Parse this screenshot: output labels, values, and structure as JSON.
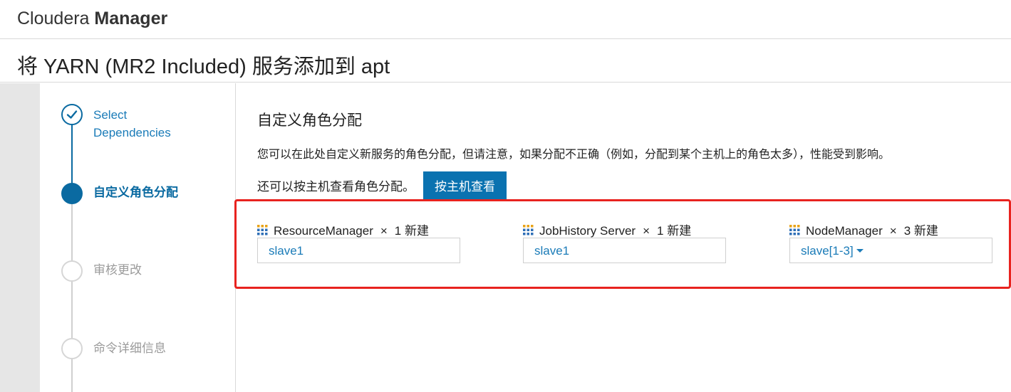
{
  "brand": {
    "light": "Cloudera",
    "bold": "Manager"
  },
  "page_title": "将 YARN (MR2 Included) 服务添加到 apt",
  "steps": [
    {
      "label": "Select Dependencies",
      "state": "done",
      "line1": "Select",
      "line2": "Dependencies"
    },
    {
      "label": "自定义角色分配",
      "state": "active"
    },
    {
      "label": "审核更改",
      "state": "pending"
    },
    {
      "label": "命令详细信息",
      "state": "pending"
    }
  ],
  "section_title": "自定义角色分配",
  "description": "您可以在此处自定义新服务的角色分配，但请注意，如果分配不正确（例如，分配到某个主机上的角色太多），性能受到影响。",
  "hint": "还可以按主机查看角色分配。",
  "view_by_host_button": "按主机查看",
  "roles": [
    {
      "name": "ResourceManager",
      "times": "×",
      "count": "1 新建",
      "host": "slave1",
      "dropdown": false
    },
    {
      "name": "JobHistory Server",
      "times": "×",
      "count": "1 新建",
      "host": "slave1",
      "dropdown": false
    },
    {
      "name": "NodeManager",
      "times": "×",
      "count": "3 新建",
      "host": "slave[1-3]",
      "dropdown": true
    }
  ],
  "icons": {
    "role": "role-grid-icon",
    "done": "check-icon",
    "dropdown": "caret-down-icon"
  },
  "colors": {
    "accent": "#0a6aa1",
    "button": "#0a72b0",
    "link": "#1a7bb8",
    "highlight": "#e8231f"
  }
}
